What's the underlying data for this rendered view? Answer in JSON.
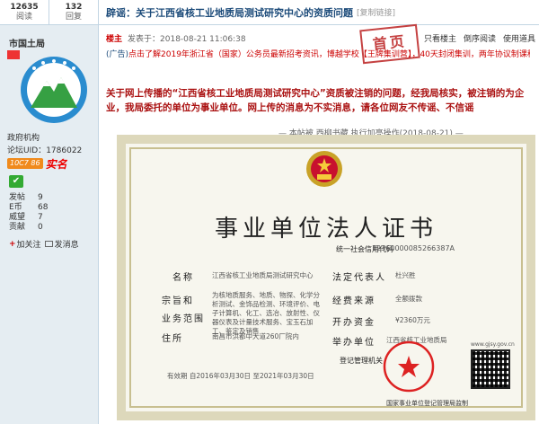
{
  "sidebar": {
    "stats": [
      {
        "num": "12635",
        "label": "阅读"
      },
      {
        "num": "132",
        "label": "回复"
      }
    ],
    "username": "市国土局",
    "group": "政府机构",
    "uid_label": "论坛UID：",
    "uid": "1786022",
    "verify_badge": "10C7 86",
    "verify_text": "实名",
    "user_stats": [
      {
        "k": "发帖",
        "v": "9"
      },
      {
        "k": "E币",
        "v": "68"
      },
      {
        "k": "威望",
        "v": "7"
      },
      {
        "k": "贡献",
        "v": "0"
      }
    ],
    "follow_label": "加关注",
    "message_label": "发消息"
  },
  "post": {
    "title": "辟谣：关于江西省核工业地质局测试研究中心的资质问题",
    "copy_link": "[复制链接]",
    "owner_tag": "楼主",
    "post_time": "发表于：2018-08-21 11:06:38",
    "actions": [
      "只看楼主",
      "倒序阅读",
      "使用道具"
    ],
    "stamp": "首页",
    "ad_prefix": "(广告)",
    "ad_text": "点击了解2019年浙江省（国家）公务员最新招考资讯，博越学校【王牌集训营】，40天封闭集训，两年协议制课程",
    "content": "关于网上传播的“江西省核工业地质局测试研究中心”资质被注销的问题，经我局核实，被注销的为企业，我局委托的单位为事业单位。网上传的消息为不实消息，请各位网友不传谣、不信谣",
    "edit_note": "— 本帖被 西柳书藏 执行加亮操作(2018-08-21) —"
  },
  "certificate": {
    "title": "事业单位法人证书",
    "code_label": "统一社会信用代码",
    "code_value": "12360000085266387A",
    "fields": [
      {
        "k": "名称",
        "v": "江西省核工业地质局测试研究中心"
      },
      {
        "k": "法定代表人",
        "v": "杜兴胜"
      },
      {
        "k": "宗旨和",
        "v": "为核地质服务、地质、物探、化学分析测试、金饰品检测、环境评价、电子计算机、化工、选冶、放射性、仪器仪表及计量技术服务、宝玉石加工、鉴定及销售"
      },
      {
        "k": "业务范围",
        "v": ""
      },
      {
        "k": "经费来源",
        "v": "全额拨款"
      },
      {
        "k": "开办资金",
        "v": "¥2360万元"
      },
      {
        "k": "住所",
        "v": "南昌市洪都中大道260厂院内"
      },
      {
        "k": "举办单位",
        "v": "江西省核工业地质局"
      }
    ],
    "validity": "有效期 自2016年03月30日 至2021年03月30日",
    "registrar": "登记管理机关",
    "qr_site": "www.gjsy.gov.cn",
    "footer": "国家事业单位登记管理局监制"
  },
  "colors": {
    "accent": "#1c4b7a",
    "red": "#c00000",
    "panel": "#e5edf2"
  }
}
